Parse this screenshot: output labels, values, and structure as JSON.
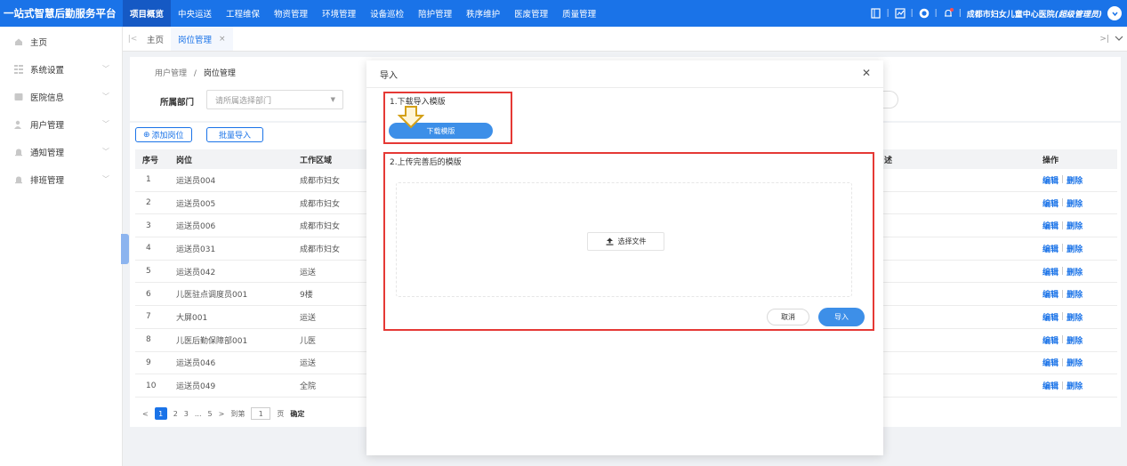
{
  "topbar": {
    "brand": "一站式智慧后勤服务平台",
    "nav": [
      "项目概览",
      "中央运送",
      "工程维保",
      "物资管理",
      "环境管理",
      "设备巡检",
      "陪护管理",
      "秩序维护",
      "医废管理",
      "质量管理"
    ],
    "active_index": 0,
    "separator": "|",
    "user_org": "成都市妇女儿童中心医院",
    "user_role": "(超级管理员)"
  },
  "sidebar": {
    "items": [
      {
        "label": "主页",
        "icon": "home-icon",
        "has_children": false
      },
      {
        "label": "系统设置",
        "icon": "grid-icon",
        "has_children": true
      },
      {
        "label": "医院信息",
        "icon": "hospital-icon",
        "has_children": true
      },
      {
        "label": "用户管理",
        "icon": "user-icon",
        "has_children": true
      },
      {
        "label": "通知管理",
        "icon": "bell-icon",
        "has_children": true
      },
      {
        "label": "排班管理",
        "icon": "bell-icon",
        "has_children": true
      }
    ]
  },
  "tabs": {
    "items": [
      {
        "label": "主页",
        "active": false,
        "closable": false
      },
      {
        "label": "岗位管理",
        "active": true,
        "closable": true
      }
    ],
    "close_glyph": "×"
  },
  "breadcrumb": {
    "parent": "用户管理",
    "separator": "/",
    "current": "岗位管理"
  },
  "filter": {
    "label": "所属部门",
    "placeholder": "请所属选择部门"
  },
  "actions": {
    "add": "添加岗位",
    "batch_import": "批量导入"
  },
  "table": {
    "headers": {
      "no": "序号",
      "position": "岗位",
      "area": "工作区域",
      "desc": "述",
      "op": "操作"
    },
    "op_edit": "编辑",
    "op_delete": "删除",
    "op_sep": "|",
    "rows": [
      {
        "no": "1",
        "position": "运送员004",
        "area": "成都市妇女"
      },
      {
        "no": "2",
        "position": "运送员005",
        "area": "成都市妇女"
      },
      {
        "no": "3",
        "position": "运送员006",
        "area": "成都市妇女"
      },
      {
        "no": "4",
        "position": "运送员031",
        "area": "成都市妇女"
      },
      {
        "no": "5",
        "position": "运送员042",
        "area": "运送"
      },
      {
        "no": "6",
        "position": "儿医驻点调度员001",
        "area": "9楼"
      },
      {
        "no": "7",
        "position": "大屏001",
        "area": "运送"
      },
      {
        "no": "8",
        "position": "儿医后勤保障部001",
        "area": "儿医"
      },
      {
        "no": "9",
        "position": "运送员046",
        "area": "运送"
      },
      {
        "no": "10",
        "position": "运送员049",
        "area": "全院"
      }
    ]
  },
  "pager": {
    "prev": "<",
    "current": "1",
    "pages": [
      "2",
      "3",
      "...",
      "5"
    ],
    "next": ">",
    "goto_label": "到第",
    "goto_value": "1",
    "page_unit": "页",
    "confirm": "确定"
  },
  "modal": {
    "title": "导入",
    "step1_label": "1.下载导入模版",
    "download_button": "下载模版",
    "step2_label": "2.上传完善后的模版",
    "choose_file": "选择文件",
    "cancel": "取消",
    "import": "导入"
  },
  "colors": {
    "primary": "#1a73e8",
    "highlight_border": "#e53935",
    "arrow": "#d4a017"
  }
}
